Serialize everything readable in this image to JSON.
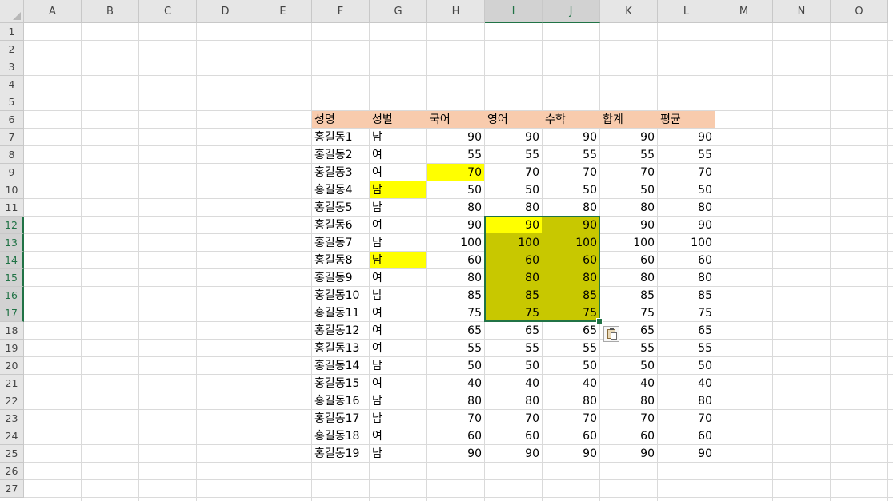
{
  "columns": [
    "A",
    "B",
    "C",
    "D",
    "E",
    "F",
    "G",
    "H",
    "I",
    "J",
    "K",
    "L",
    "M",
    "N",
    "O"
  ],
  "selected_columns": [
    "I",
    "J"
  ],
  "row_count": 27,
  "selected_rows": [
    12,
    13,
    14,
    15,
    16,
    17
  ],
  "colors": {
    "header_fill": "#f8cbad",
    "highlight_yellow": "#ffff00",
    "selection_olive": "#c8c800",
    "selection_border": "#217346"
  },
  "selection": {
    "range": "I12:J17",
    "active_cell": "I12"
  },
  "paste_options_icon": "paste-options-icon",
  "table": {
    "headers": [
      "성명",
      "성별",
      "국어",
      "영어",
      "수학",
      "합계",
      "평균"
    ],
    "rows": [
      [
        "홍길동1",
        "남",
        "90",
        "90",
        "90",
        "90",
        "90"
      ],
      [
        "홍길동2",
        "여",
        "55",
        "55",
        "55",
        "55",
        "55"
      ],
      [
        "홍길동3",
        "여",
        "70",
        "70",
        "70",
        "70",
        "70"
      ],
      [
        "홍길동4",
        "남",
        "50",
        "50",
        "50",
        "50",
        "50"
      ],
      [
        "홍길동5",
        "남",
        "80",
        "80",
        "80",
        "80",
        "80"
      ],
      [
        "홍길동6",
        "여",
        "90",
        "90",
        "90",
        "90",
        "90"
      ],
      [
        "홍길동7",
        "남",
        "100",
        "100",
        "100",
        "100",
        "100"
      ],
      [
        "홍길동8",
        "남",
        "60",
        "60",
        "60",
        "60",
        "60"
      ],
      [
        "홍길동9",
        "여",
        "80",
        "80",
        "80",
        "80",
        "80"
      ],
      [
        "홍길동10",
        "남",
        "85",
        "85",
        "85",
        "85",
        "85"
      ],
      [
        "홍길동11",
        "여",
        "75",
        "75",
        "75",
        "75",
        "75"
      ],
      [
        "홍길동12",
        "여",
        "65",
        "65",
        "65",
        "65",
        "65"
      ],
      [
        "홍길동13",
        "여",
        "55",
        "55",
        "55",
        "55",
        "55"
      ],
      [
        "홍길동14",
        "남",
        "50",
        "50",
        "50",
        "50",
        "50"
      ],
      [
        "홍길동15",
        "여",
        "40",
        "40",
        "40",
        "40",
        "40"
      ],
      [
        "홍길동16",
        "남",
        "80",
        "80",
        "80",
        "80",
        "80"
      ],
      [
        "홍길동17",
        "남",
        "70",
        "70",
        "70",
        "70",
        "70"
      ],
      [
        "홍길동18",
        "여",
        "60",
        "60",
        "60",
        "60",
        "60"
      ],
      [
        "홍길동19",
        "남",
        "90",
        "90",
        "90",
        "90",
        "90"
      ]
    ]
  },
  "highlighted_cells": [
    "H9",
    "G10",
    "G14"
  ]
}
